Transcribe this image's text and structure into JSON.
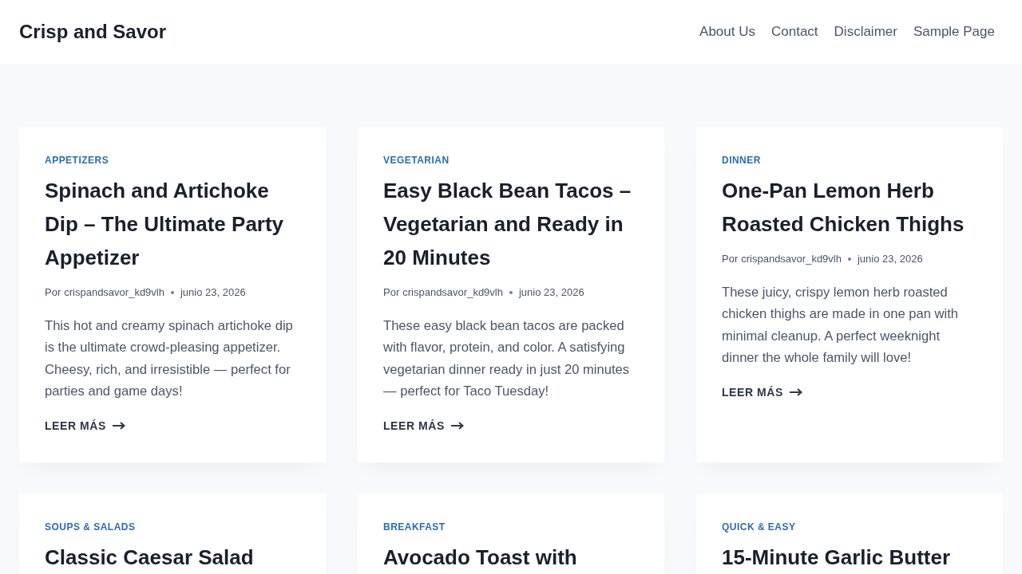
{
  "site": {
    "title": "Crisp and Savor"
  },
  "nav": [
    {
      "label": "About Us"
    },
    {
      "label": "Contact"
    },
    {
      "label": "Disclaimer"
    },
    {
      "label": "Sample Page"
    }
  ],
  "posts": [
    {
      "category": "APPETIZERS",
      "title": "Spinach and Artichoke Dip – The Ultimate Party Appetizer",
      "byline_prefix": "Por",
      "author": "crispandsavor_kd9vlh",
      "date": "junio 23, 2026",
      "excerpt": "This hot and creamy spinach artichoke dip is the ultimate crowd-pleasing appetizer. Cheesy, rich, and irresistible — perfect for parties and game days!",
      "read_more": "LEER MÁS"
    },
    {
      "category": "VEGETARIAN",
      "title": "Easy Black Bean Tacos – Vegetarian and Ready in 20 Minutes",
      "byline_prefix": "Por",
      "author": "crispandsavor_kd9vlh",
      "date": "junio 23, 2026",
      "excerpt": "These easy black bean tacos are packed with flavor, protein, and color. A satisfying vegetarian dinner ready in just 20 minutes — perfect for Taco Tuesday!",
      "read_more": "LEER MÁS"
    },
    {
      "category": "DINNER",
      "title": "One-Pan Lemon Herb Roasted Chicken Thighs",
      "byline_prefix": "Por",
      "author": "crispandsavor_kd9vlh",
      "date": "junio 23, 2026",
      "excerpt": "These juicy, crispy lemon herb roasted chicken thighs are made in one pan with minimal cleanup. A perfect weeknight dinner the whole family will love!",
      "read_more": "LEER MÁS"
    },
    {
      "category": "SOUPS & SALADS",
      "title": "Classic Caesar Salad"
    },
    {
      "category": "BREAKFAST",
      "title": "Avocado Toast with"
    },
    {
      "category": "QUICK & EASY",
      "title": "15-Minute Garlic Butter"
    }
  ]
}
